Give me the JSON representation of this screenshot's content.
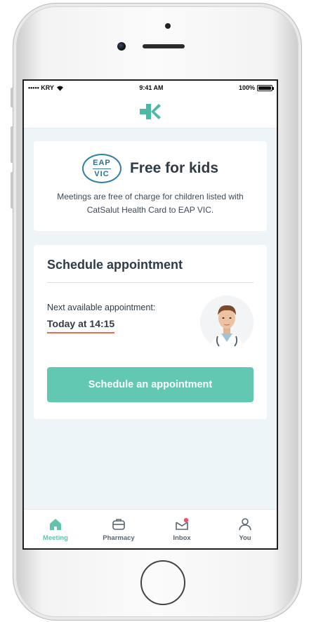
{
  "status_bar": {
    "carrier": "••••• KRY",
    "time": "9:41 AM",
    "battery": "100%"
  },
  "kids_card": {
    "badge_top": "EAP",
    "badge_bottom": "VIC",
    "title": "Free for kids",
    "description": "Meetings are free of charge for children listed with CatSalut Health Card to EAP VIC."
  },
  "schedule_card": {
    "title": "Schedule appointment",
    "next_label": "Next available appointment:",
    "next_time": "Today at 14:15",
    "button_label": "Schedule an appointment"
  },
  "tabs": [
    {
      "label": "Meeting",
      "icon": "home-icon",
      "active": true
    },
    {
      "label": "Pharmacy",
      "icon": "pharmacy-icon",
      "active": false
    },
    {
      "label": "Inbox",
      "icon": "inbox-icon",
      "active": false
    },
    {
      "label": "You",
      "icon": "user-icon",
      "active": false
    }
  ],
  "colors": {
    "accent": "#62c8b1",
    "underline": "#e86b54",
    "notification": "#f0506e",
    "text": "#2e3c47"
  }
}
